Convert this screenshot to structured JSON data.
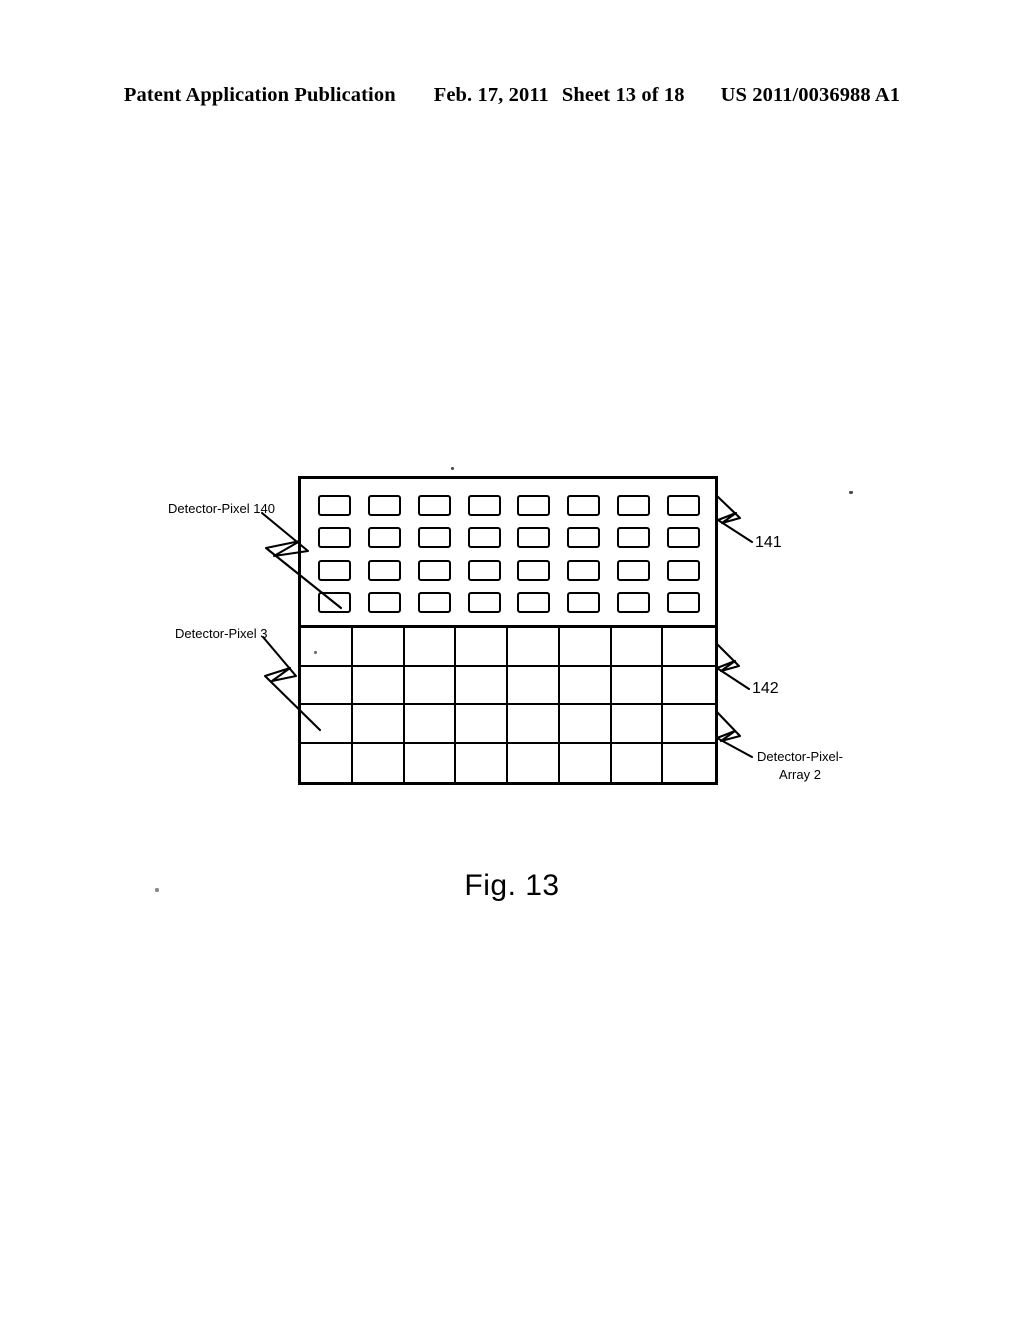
{
  "header": {
    "publication": "Patent Application Publication",
    "date": "Feb. 17, 2011",
    "sheet": "Sheet 13 of 18",
    "patent_number": "US 2011/0036988 A1"
  },
  "figure": {
    "caption": "Fig. 13",
    "labels": {
      "detector_pixel_140": "Detector-Pixel 140",
      "detector_pixel_3": "Detector-Pixel 3",
      "ref_141": "141",
      "ref_142": "142",
      "detector_pixel_array_2_line1": "Detector-Pixel-",
      "detector_pixel_array_2_line2": "Array 2"
    },
    "upper_region": {
      "columns": 8,
      "rows": 4,
      "pixel_count": 32
    },
    "lower_region": {
      "columns": 8,
      "rows": 4,
      "cell_count": 32
    },
    "colors": {
      "ink": "#000000",
      "paper": "#ffffff"
    }
  }
}
